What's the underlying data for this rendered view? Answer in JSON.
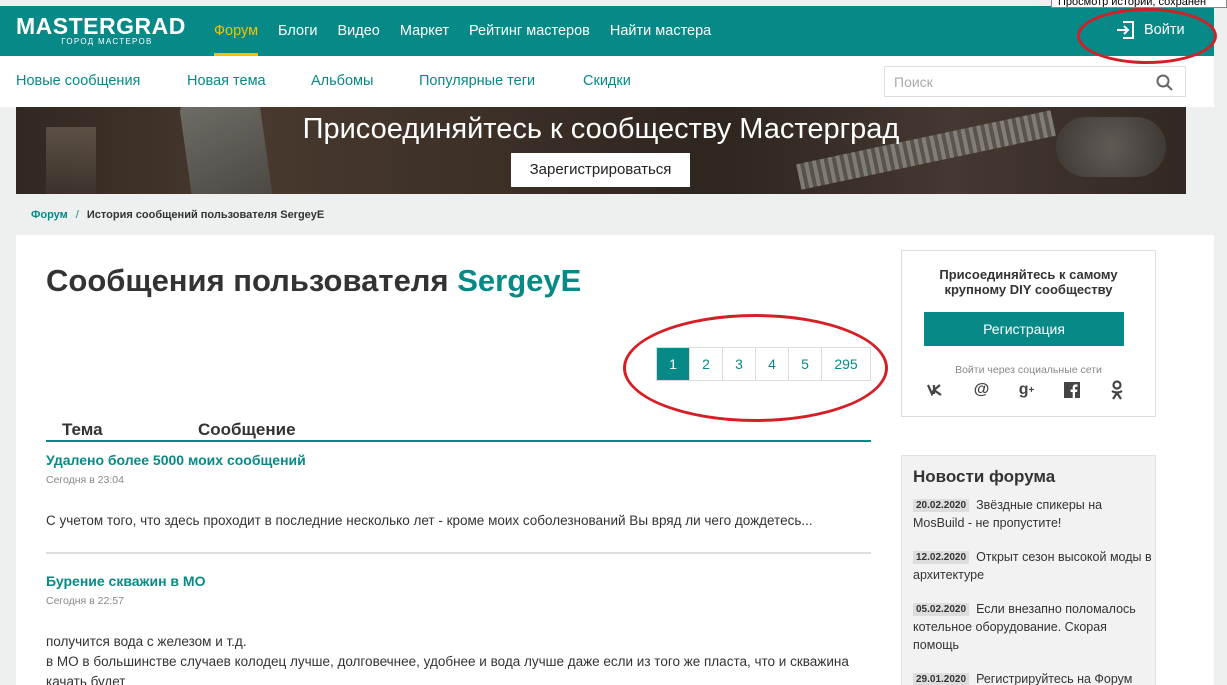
{
  "tooltip": "Просмотр истории, сохранен",
  "brand": {
    "name": "MASTERGRAD",
    "tagline": "ГОРОД МАСТЕРОВ"
  },
  "nav": [
    "Форум",
    "Блоги",
    "Видео",
    "Маркет",
    "Рейтинг мастеров",
    "Найти мастера"
  ],
  "login_label": "Войти",
  "subnav": [
    "Новые сообщения",
    "Новая тема",
    "Альбомы",
    "Популярные теги",
    "Скидки"
  ],
  "search": {
    "placeholder": "Поиск"
  },
  "banner": {
    "title": "Присоединяйтесь к сообществу Мастерград",
    "button": "Зарегистрироваться"
  },
  "breadcrumb": {
    "root": "Форум",
    "separator": "/",
    "current": "История сообщений пользователя SergeyE"
  },
  "page_title": {
    "prefix": "Сообщения пользователя",
    "username": "SergeyE"
  },
  "pagination": [
    "1",
    "2",
    "3",
    "4",
    "5",
    "295"
  ],
  "list_header": {
    "topic": "Тема",
    "message": "Сообщение"
  },
  "posts": [
    {
      "title": "Удалено более 5000 моих сообщений",
      "time": "Сегодня в 23:04",
      "text": "С учетом того, что здесь проходит в последние несколько лет - кроме моих соболезнований Вы вряд ли чего дождетесь..."
    },
    {
      "title": "Бурение скважин в МО",
      "time": "Сегодня в 22:57",
      "text": "получится вода с железом и т.д.\nв МО в большинстве случаев колодец лучше, долговечнее, удобнее и вода лучше даже если из того же пласта, что и скважина качать будет"
    }
  ],
  "sidebar": {
    "join_text": "Присоединяйтесь к самому крупному DIY сообществу",
    "register_button": "Регистрация",
    "social_caption": "Войти через социальные сети",
    "socials": [
      "vk-icon",
      "mail-icon",
      "google-plus-icon",
      "facebook-icon",
      "odnoklassniki-icon"
    ]
  },
  "news": {
    "title": "Новости форума",
    "items": [
      {
        "date": "20.02.2020",
        "text": "Звёздные спикеры на MosBuild - не пропустите!"
      },
      {
        "date": "12.02.2020",
        "text": "Открыт сезон высокой моды в архитектуре"
      },
      {
        "date": "05.02.2020",
        "text": "Если внезапно поломалось котельное оборудование. Скорая помощь"
      },
      {
        "date": "29.01.2020",
        "text": "Регистрируйтесь на Форум"
      }
    ]
  },
  "colors": {
    "brand": "#078a87",
    "accent": "#f2c200",
    "annotation": "#d41f26"
  }
}
